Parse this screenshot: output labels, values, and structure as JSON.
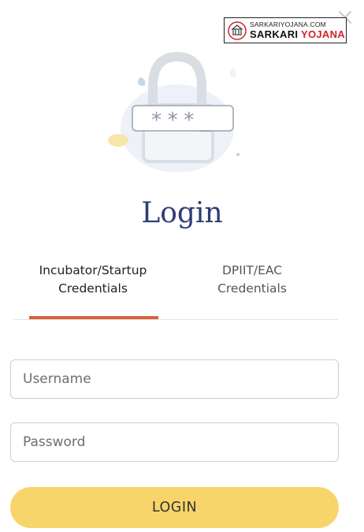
{
  "watermark": {
    "site": "SARKARIYOJANA.COM",
    "brand_part1": "SARKARI",
    "brand_part2": "YOJANA"
  },
  "illustration": {
    "password_mask": "***_"
  },
  "header": {
    "title": "Login"
  },
  "tabs": [
    {
      "line1": "Incubator/Startup",
      "line2": "Credentials",
      "active": true
    },
    {
      "line1": "DPIIT/EAC",
      "line2": "Credentials",
      "active": false
    }
  ],
  "form": {
    "username_placeholder": "Username",
    "password_placeholder": "Password",
    "submit_label": "LOGIN"
  },
  "colors": {
    "title": "#2f3d74",
    "active_tab_indicator": "#d9633e",
    "login_button": "#f8d56b",
    "brand_red": "#d2232a"
  },
  "icons": [
    "close-icon",
    "padlock-icon",
    "seal-icon"
  ]
}
